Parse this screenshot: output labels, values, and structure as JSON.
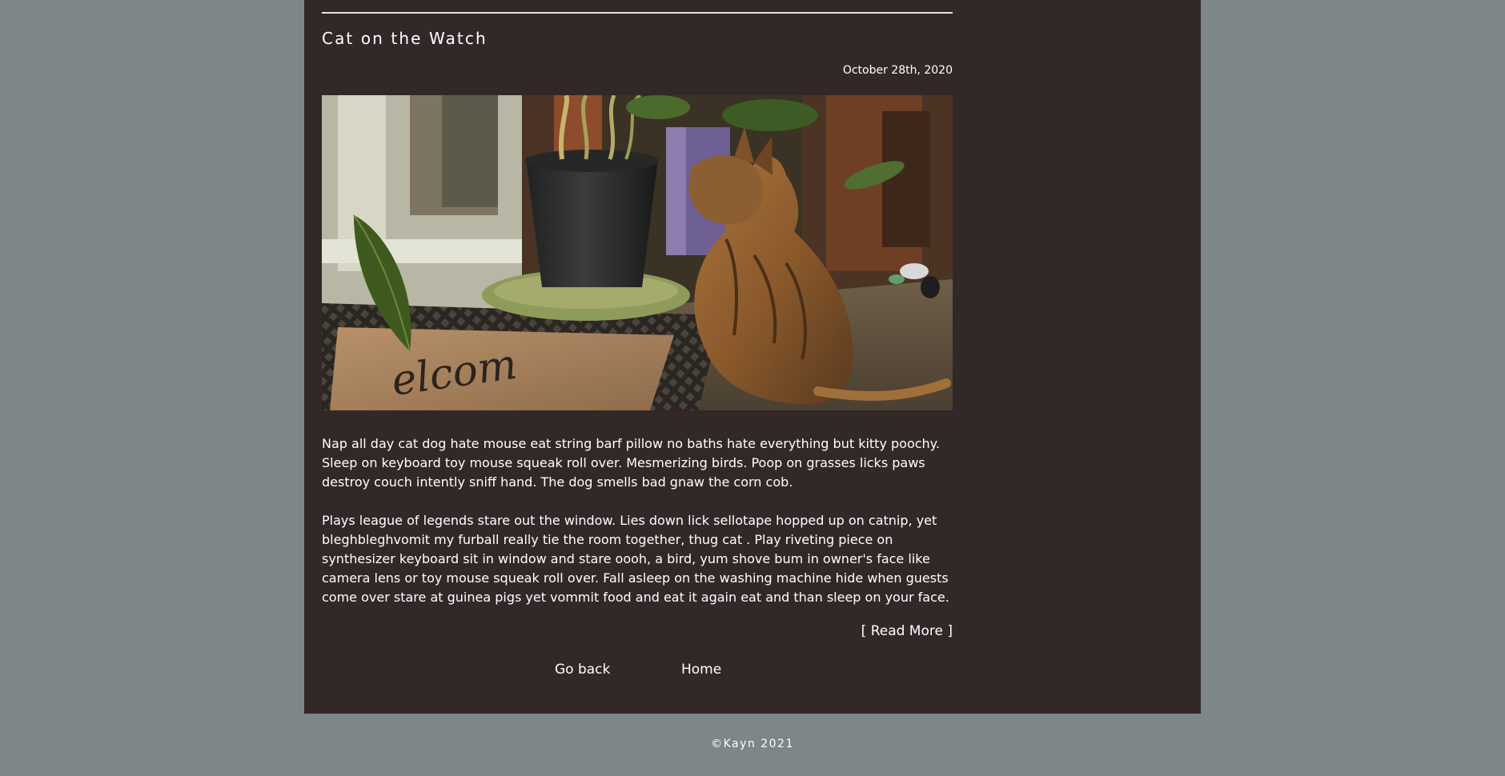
{
  "post": {
    "title": "Cat on the Watch",
    "date": "October 28th, 2020",
    "paragraphs": [
      "Nap all day cat dog hate mouse eat string barf pillow no baths hate everything but kitty poochy. Sleep on keyboard toy mouse squeak roll over. Mesmerizing birds. Poop on grasses licks paws destroy couch intently sniff hand. The dog smells bad gnaw the corn cob.",
      "Plays league of legends stare out the window. Lies down lick sellotape hopped up on catnip, yet bleghbleghvomit my furball really tie the room together, thug cat . Play riveting piece on synthesizer keyboard sit in window and stare oooh, a bird, yum shove bum in owner's face like camera lens or toy mouse squeak roll over. Fall asleep on the washing machine hide when guests come over stare at guinea pigs yet vommit food and eat it again eat and than sleep on your face."
    ],
    "read_more": "[ Read More ]",
    "image": {
      "mat_text": "elcom"
    }
  },
  "nav": {
    "back": "Go back",
    "home": "Home"
  },
  "footer": {
    "text": "©Kayn 2021"
  },
  "colors": {
    "page_bg": "#7d8787",
    "panel_bg": "#322827",
    "text": "#ffffff"
  }
}
